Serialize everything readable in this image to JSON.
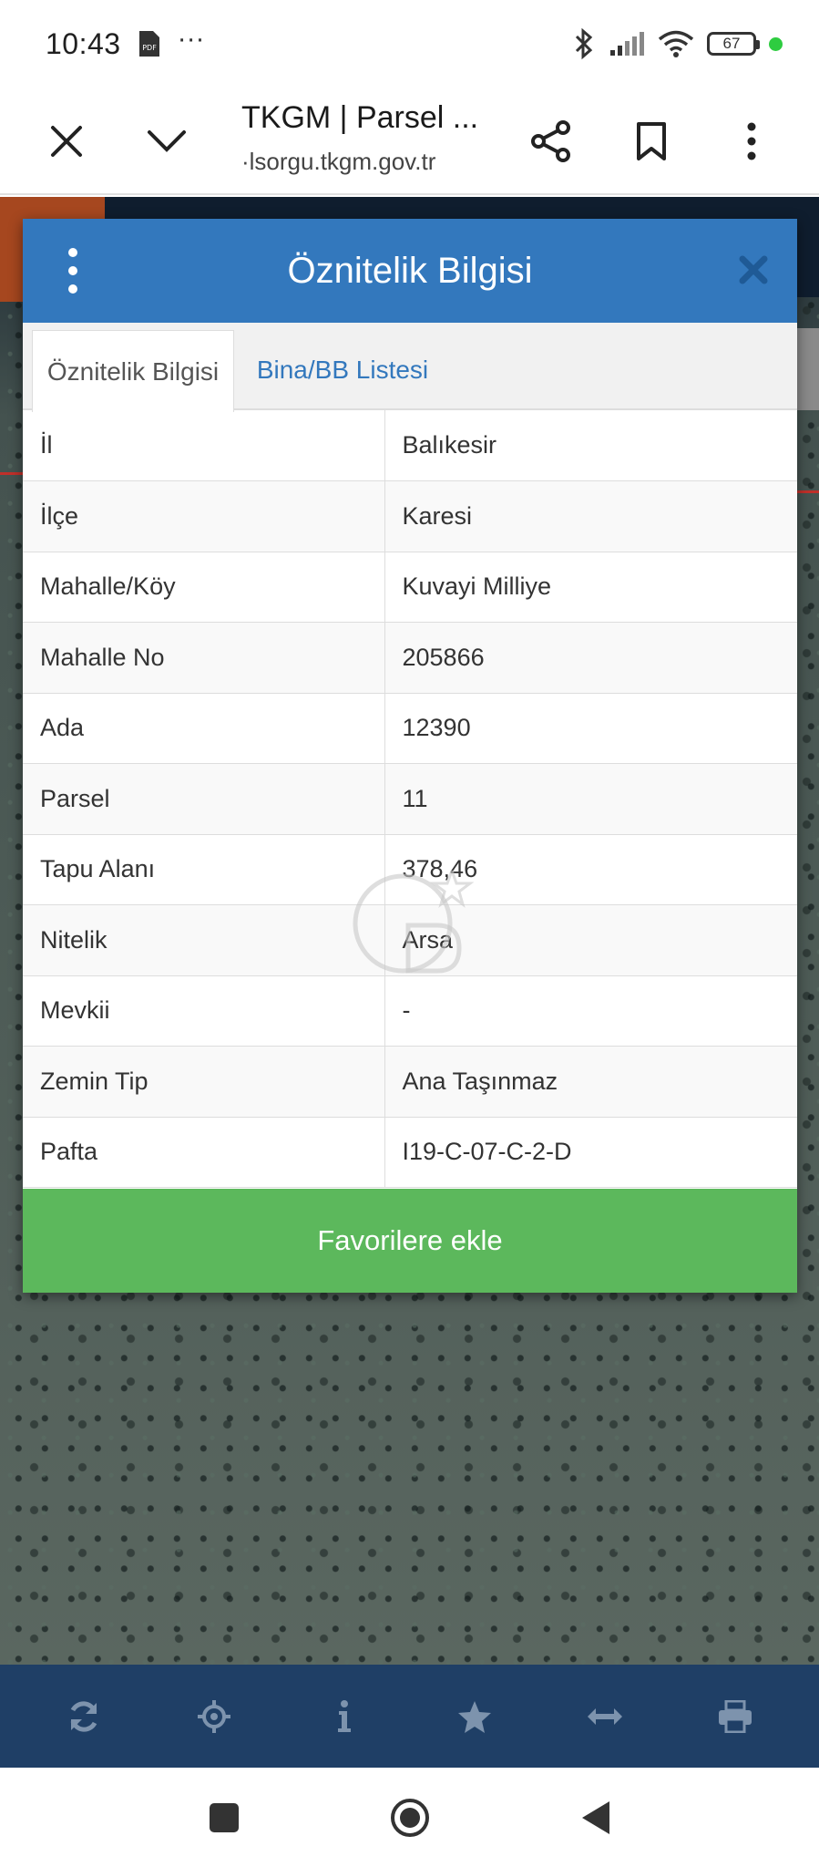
{
  "status_bar": {
    "time": "10:43",
    "pdf_badge": "PDF",
    "more_dots": "···",
    "battery": "67",
    "icons": [
      "pdf-icon",
      "bluetooth-icon",
      "signal-icon",
      "wifi-icon",
      "battery-icon"
    ]
  },
  "browser": {
    "title": "TKGM | Parsel ...",
    "url": "·lsorgu.tkgm.gov.tr"
  },
  "modal": {
    "title": "Öznitelik Bilgisi",
    "tabs": [
      {
        "label": "Öznitelik Bilgisi",
        "active": true
      },
      {
        "label": "Bina/BB Listesi",
        "active": false
      }
    ],
    "rows": [
      {
        "key": "İl",
        "value": "Balıkesir"
      },
      {
        "key": "İlçe",
        "value": "Karesi"
      },
      {
        "key": "Mahalle/Köy",
        "value": "Kuvayi Milliye"
      },
      {
        "key": "Mahalle No",
        "value": "205866"
      },
      {
        "key": "Ada",
        "value": "12390"
      },
      {
        "key": "Parsel",
        "value": "11"
      },
      {
        "key": "Tapu Alanı",
        "value": "378,46"
      },
      {
        "key": "Nitelik",
        "value": "Arsa"
      },
      {
        "key": "Mevkii",
        "value": "-"
      },
      {
        "key": "Zemin Tip",
        "value": "Ana Taşınmaz"
      },
      {
        "key": "Pafta",
        "value": "I19-C-07-C-2-D"
      }
    ],
    "favorite_button": "Favorilere ekle"
  },
  "colors": {
    "header_blue": "#3378bd",
    "favorite_green": "#5cb85c",
    "toolbar_navy": "#1f3f66"
  },
  "toolbar": {
    "icons": [
      "refresh-icon",
      "crosshair-icon",
      "info-icon",
      "star-icon",
      "measure-icon",
      "print-icon"
    ]
  },
  "nav": {
    "icons": [
      "recents-icon",
      "home-icon",
      "back-icon"
    ]
  }
}
